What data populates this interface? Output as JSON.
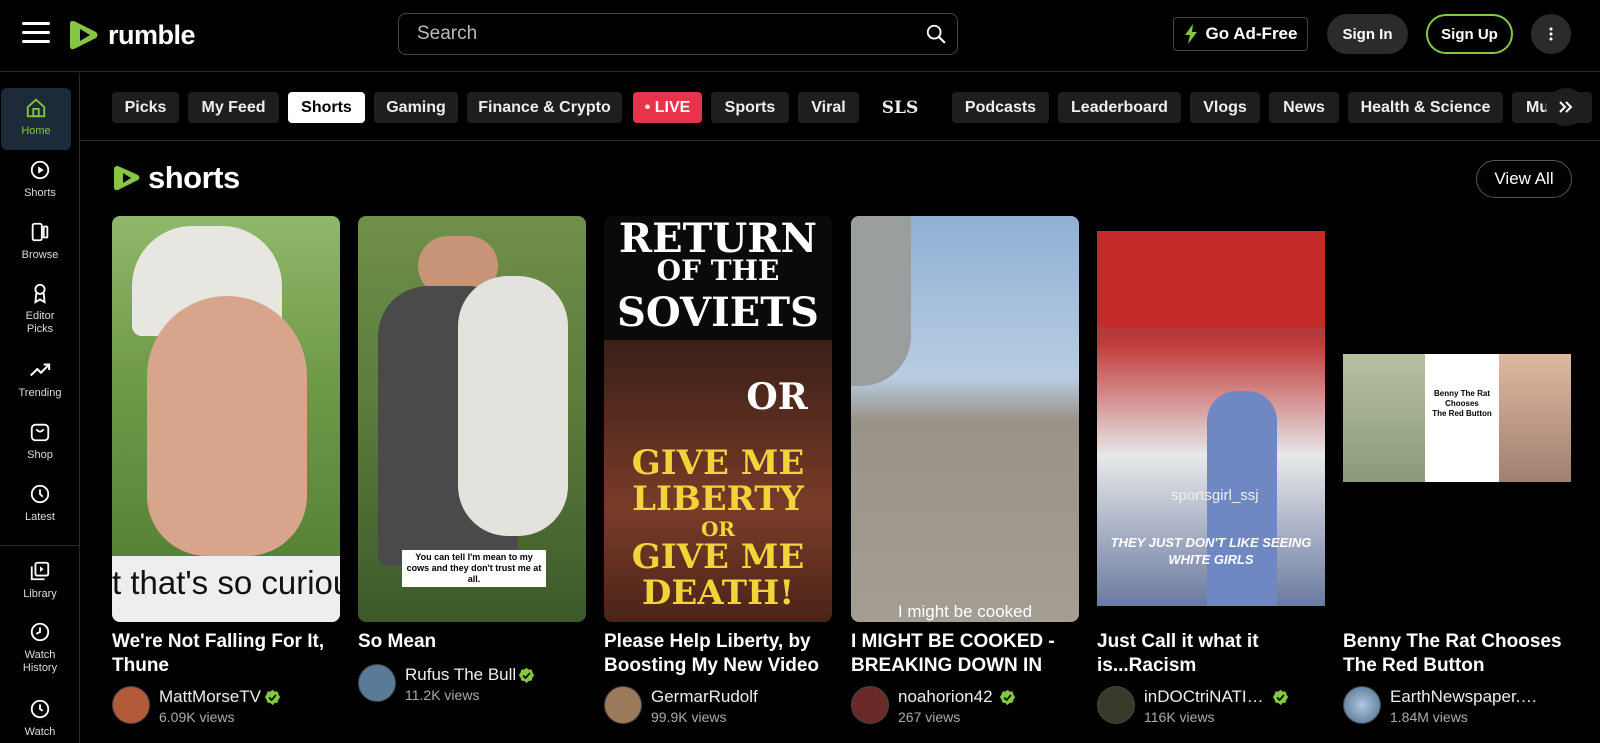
{
  "header": {
    "logo_text": "rumble",
    "search_placeholder": "Search",
    "ad_free_label": "Go Ad-Free",
    "sign_in_label": "Sign In",
    "sign_up_label": "Sign Up"
  },
  "sidebar": {
    "items": [
      {
        "label": "Home",
        "icon": "home-icon"
      },
      {
        "label": "Shorts",
        "icon": "shorts-icon"
      },
      {
        "label": "Browse",
        "icon": "browse-icon"
      },
      {
        "label": "Editor Picks",
        "icon": "editor-picks-icon"
      },
      {
        "label": "Trending",
        "icon": "trending-icon"
      },
      {
        "label": "Shop",
        "icon": "shop-icon"
      },
      {
        "label": "Latest",
        "icon": "latest-icon"
      },
      {
        "label": "Library",
        "icon": "library-icon"
      },
      {
        "label": "Watch History",
        "icon": "watch-history-icon"
      },
      {
        "label": "Watch",
        "icon": "watch-later-icon"
      }
    ]
  },
  "categories": [
    "Picks",
    "My Feed",
    "Shorts",
    "Gaming",
    "Finance & Crypto",
    "• LIVE",
    "Sports",
    "Viral",
    "SLS",
    "Podcasts",
    "Leaderboard",
    "Vlogs",
    "News",
    "Health & Science",
    "Music"
  ],
  "active_category": "Shorts",
  "shorts": {
    "logo_text": "shorts",
    "view_all_label": "View All",
    "cards": [
      {
        "title": "We're Not Falling For It, Thune",
        "channel": "MattMorseTV",
        "views": "6.09K views",
        "verified": true,
        "overlay": "t that's so curiou ause right this v"
      },
      {
        "title": "So Mean",
        "channel": "Rufus The Bull",
        "views": "11.2K views",
        "verified": true,
        "overlay": "You can tell I'm mean to my cows and they don't trust me at all."
      },
      {
        "title": "Please Help Liberty, by Boosting My New Video",
        "channel": "GermarRudolf",
        "views": "99.9K views",
        "verified": false,
        "overlay": [
          "RETURN",
          "OF THE",
          "SOVIETS",
          "OR",
          "GIVE ME",
          "LIBERTY",
          "OR",
          "GIVE ME",
          "DEATH!"
        ]
      },
      {
        "title": "I MIGHT BE COOKED - BREAKING DOWN IN THE …",
        "channel": "noahorion42",
        "views": "267 views",
        "verified": true,
        "overlay": "I might be cooked"
      },
      {
        "title": "Just Call it what it is...Racism",
        "channel": "inDOCtriNATI…",
        "views": "116K views",
        "verified": true,
        "overlay": [
          "THEY JUST DON'T LIKE SEEING",
          "WHITE GIRLS"
        ],
        "watermark": "sportsgirl_ssj"
      },
      {
        "title": "Benny The Rat Chooses The Red Button",
        "channel": "EarthNewspaper.…",
        "views": "1.84M views",
        "verified": false,
        "overlay": [
          "Benny The Rat",
          "Chooses",
          "The Red Button"
        ]
      }
    ]
  },
  "colors": {
    "accent": "#85c742",
    "live": "#e8334a"
  }
}
